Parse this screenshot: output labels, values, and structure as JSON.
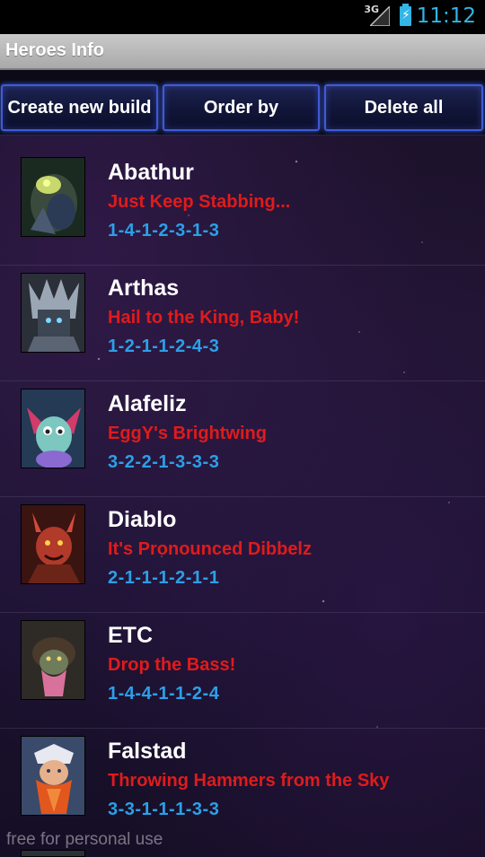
{
  "status_bar": {
    "network": "3G",
    "time": "11:12",
    "accent": "#33b5e5"
  },
  "app": {
    "title": "Heroes Info"
  },
  "toolbar": {
    "create_label": "Create new build",
    "order_label": "Order by",
    "delete_label": "Delete all"
  },
  "colors": {
    "build_name": "#e01b1b",
    "build_code": "#2ba0e8",
    "button_border": "#3f5bd8"
  },
  "heroes": [
    {
      "name": "Abathur",
      "build": "Just Keep Stabbing...",
      "code": "1-4-1-2-3-1-3",
      "icon": "abathur-portrait"
    },
    {
      "name": "Arthas",
      "build": "Hail to the King, Baby!",
      "code": "1-2-1-1-2-4-3",
      "icon": "arthas-portrait"
    },
    {
      "name": "Alafeliz",
      "build": "EggY's Brightwing",
      "code": "3-2-2-1-3-3-3",
      "icon": "brightwing-portrait"
    },
    {
      "name": "Diablo",
      "build": "It's Pronounced Dibbelz",
      "code": "2-1-1-1-2-1-1",
      "icon": "diablo-portrait"
    },
    {
      "name": "ETC",
      "build": "Drop the Bass!",
      "code": "1-4-4-1-1-2-4",
      "icon": "etc-portrait"
    },
    {
      "name": "Falstad",
      "build": "Throwing Hammers from the Sky",
      "code": "3-3-1-1-1-3-3",
      "icon": "falstad-portrait"
    }
  ],
  "watermark": "free for personal use"
}
